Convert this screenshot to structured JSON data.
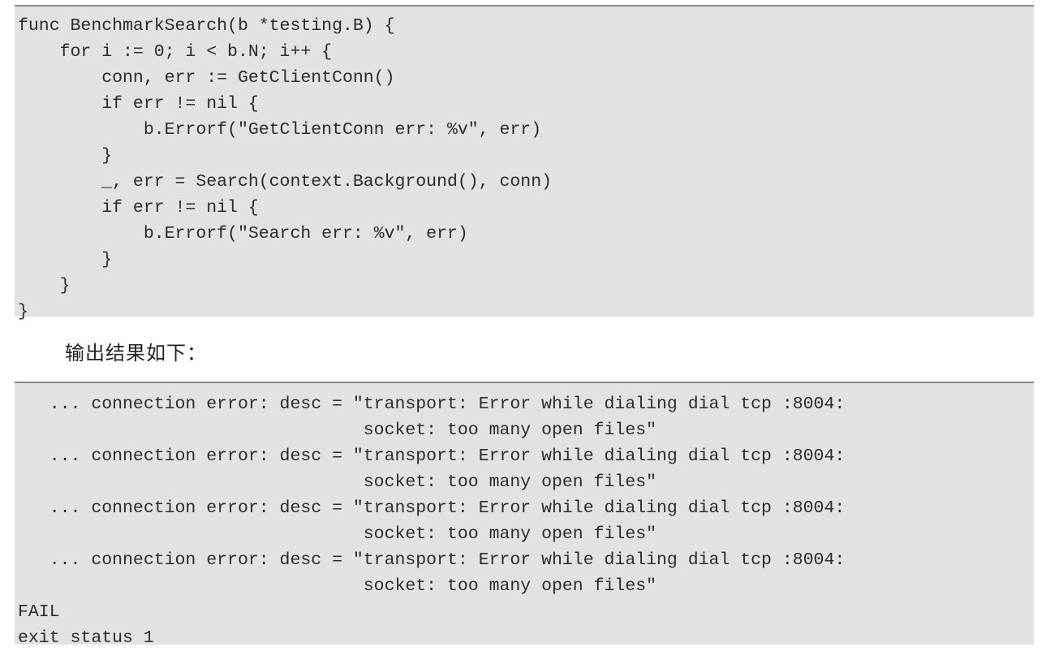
{
  "code_block_1": {
    "lines": [
      "func BenchmarkSearch(b *testing.B) {",
      "    for i := 0; i < b.N; i++ {",
      "        conn, err := GetClientConn()",
      "        if err != nil {",
      "            b.Errorf(\"GetClientConn err: %v\", err)",
      "        }",
      "        _, err = Search(context.Background(), conn)",
      "        if err != nil {",
      "            b.Errorf(\"Search err: %v\", err)",
      "        }",
      "    }",
      "}"
    ]
  },
  "caption": "输出结果如下：",
  "code_block_2": {
    "lines": [
      "   ... connection error: desc = \"transport: Error while dialing dial tcp :8004:",
      "                                 socket: too many open files\"",
      "   ... connection error: desc = \"transport: Error while dialing dial tcp :8004:",
      "                                 socket: too many open files\"",
      "   ... connection error: desc = \"transport: Error while dialing dial tcp :8004:",
      "                                 socket: too many open files\"",
      "   ... connection error: desc = \"transport: Error while dialing dial tcp :8004:",
      "                                 socket: too many open files\"",
      "FAIL",
      "exit status 1"
    ]
  }
}
